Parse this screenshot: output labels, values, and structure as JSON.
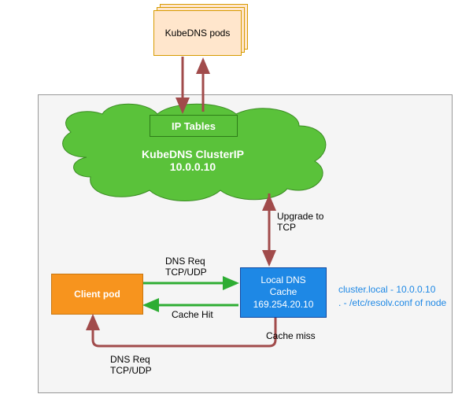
{
  "pods": {
    "label": "KubeDNS pods"
  },
  "iptables": {
    "label": "IP Tables"
  },
  "cluster": {
    "name": "KubeDNS ClusterIP",
    "ip": "10.0.0.10"
  },
  "client": {
    "label": "Client pod"
  },
  "cache": {
    "title": "Local DNS",
    "subtitle": "Cache",
    "ip": "169.254.20.10"
  },
  "labels": {
    "upgrade": "Upgrade to\nTCP",
    "dnsreq1": "DNS Req\nTCP/UDP",
    "cachehit": "Cache Hit",
    "cachemiss": "Cache miss",
    "dnsreq2": "DNS Req\nTCP/UDP"
  },
  "annotation": {
    "line1": "cluster.local - 10.0.0.10",
    "line2": ". - /etc/resolv.conf of node"
  }
}
